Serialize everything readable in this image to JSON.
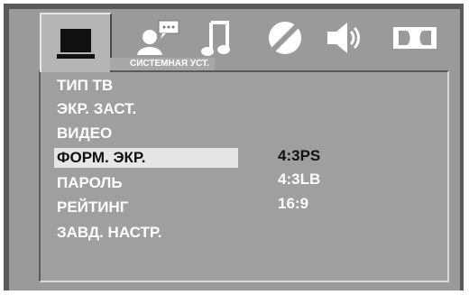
{
  "tabs": [
    {
      "icon": "monitor-icon",
      "active": true
    },
    {
      "icon": "user-speech-icon",
      "active": false
    },
    {
      "icon": "music-note-icon",
      "active": false
    },
    {
      "icon": "circle-slash-icon",
      "active": false
    },
    {
      "icon": "speaker-icon",
      "active": false
    },
    {
      "icon": "dolby-icon",
      "active": false
    }
  ],
  "section_label": "СИСТЕМНАЯ УСТ.",
  "menu": {
    "items": [
      {
        "label": "ТИП ТВ"
      },
      {
        "label": "ЭКР. ЗАСТ."
      },
      {
        "label": "ВИДЕО"
      },
      {
        "label": "ФОРМ. ЭКР.",
        "selected": true
      },
      {
        "label": "ПАРОЛЬ"
      },
      {
        "label": "РЕЙТИНГ"
      },
      {
        "label": "ЗАВД. НАСТР."
      }
    ]
  },
  "options": {
    "items": [
      {
        "label": "4:3PS",
        "current": true
      },
      {
        "label": "4:3LB"
      },
      {
        "label": "16:9"
      }
    ]
  },
  "colors": {
    "frame": "#5a5a5a",
    "panel": "#9a9a9a",
    "highlight": "#e6e6e6",
    "text": "#ffffff",
    "selected_text": "#111111"
  }
}
